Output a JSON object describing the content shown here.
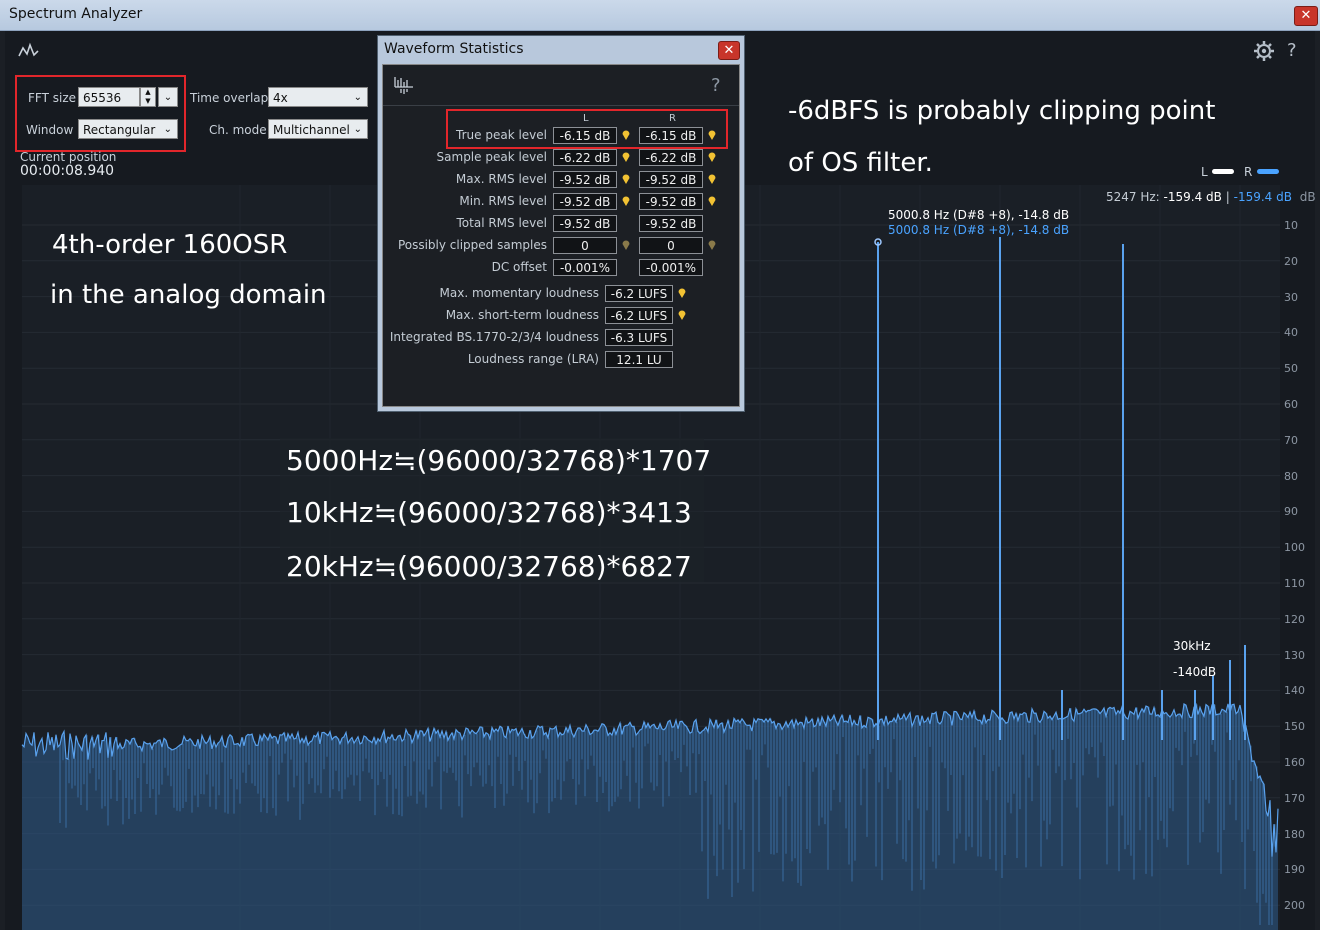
{
  "window": {
    "title": "Spectrum Analyzer",
    "close": "✕"
  },
  "controls": {
    "fft_size_label": "FFT size",
    "fft_size_value": "65536",
    "window_label": "Window",
    "window_value": "Rectangular",
    "time_overlap_label": "Time overlap",
    "time_overlap_value": "4x",
    "ch_mode_label": "Ch. mode",
    "ch_mode_value": "Multichannel",
    "current_position_label": "Current position",
    "current_position_value": "00:00:08.940"
  },
  "toolbar": {
    "help": "?"
  },
  "legend": {
    "left": "L",
    "right": "R",
    "left_color": "#ffffff",
    "right_color": "#4aa3ff"
  },
  "readout": {
    "prefix": "5247 Hz:",
    "left_db": "-159.4 dB",
    "sep": "|",
    "right_db": "-159.4 dB",
    "unit": "dB"
  },
  "peak_label": {
    "white": "5000.8 Hz (D#8 +8), -14.8 dB",
    "blue": "5000.8 Hz (D#8 +8), -14.8 dB"
  },
  "annotations": {
    "top_right_1": "-6dBFS is probably clipping point",
    "top_right_2": "of OS filter.",
    "left_1": "4th-order 160OSR",
    "left_2": "in the analog domain",
    "formula_1": "5000Hz≒(96000/32768)*1707",
    "formula_2": "10kHz≒(96000/32768)*3413",
    "formula_3": "20kHz≒(96000/32768)*6827",
    "hf_1": "30kHz",
    "hf_2": "-140dB"
  },
  "y_ticks": [
    "10",
    "20",
    "30",
    "40",
    "50",
    "60",
    "70",
    "80",
    "90",
    "100",
    "110",
    "120",
    "130",
    "140",
    "150",
    "160",
    "170",
    "180",
    "190",
    "200"
  ],
  "dialog": {
    "title": "Waveform Statistics",
    "close": "✕",
    "help": "?",
    "col_l": "L",
    "col_r": "R",
    "rows": [
      {
        "label": "True peak level",
        "l": "-6.15 dB",
        "r": "-6.15 dB"
      },
      {
        "label": "Sample peak level",
        "l": "-6.22 dB",
        "r": "-6.22 dB"
      },
      {
        "label": "Max. RMS level",
        "l": "-9.52 dB",
        "r": "-9.52 dB"
      },
      {
        "label": "Min. RMS level",
        "l": "-9.52 dB",
        "r": "-9.52 dB"
      },
      {
        "label": "Total RMS level",
        "l": "-9.52 dB",
        "r": "-9.52 dB"
      },
      {
        "label": "Possibly clipped samples",
        "l": "0",
        "r": "0"
      },
      {
        "label": "DC offset",
        "l": "-0.001%",
        "r": "-0.001%"
      }
    ],
    "loudness": [
      {
        "label": "Max. momentary loudness",
        "value": "-6.2 LUFS"
      },
      {
        "label": "Max. short-term loudness",
        "value": "-6.2 LUFS"
      },
      {
        "label": "Integrated BS.1770-2/3/4 loudness",
        "value": "-6.3 LUFS"
      },
      {
        "label": "Loudness range (LRA)",
        "value": "12.1 LU"
      }
    ]
  },
  "colors": {
    "spectrum": "#4a90d9",
    "highlight_box": "#e2262b",
    "background": "#161a20"
  }
}
